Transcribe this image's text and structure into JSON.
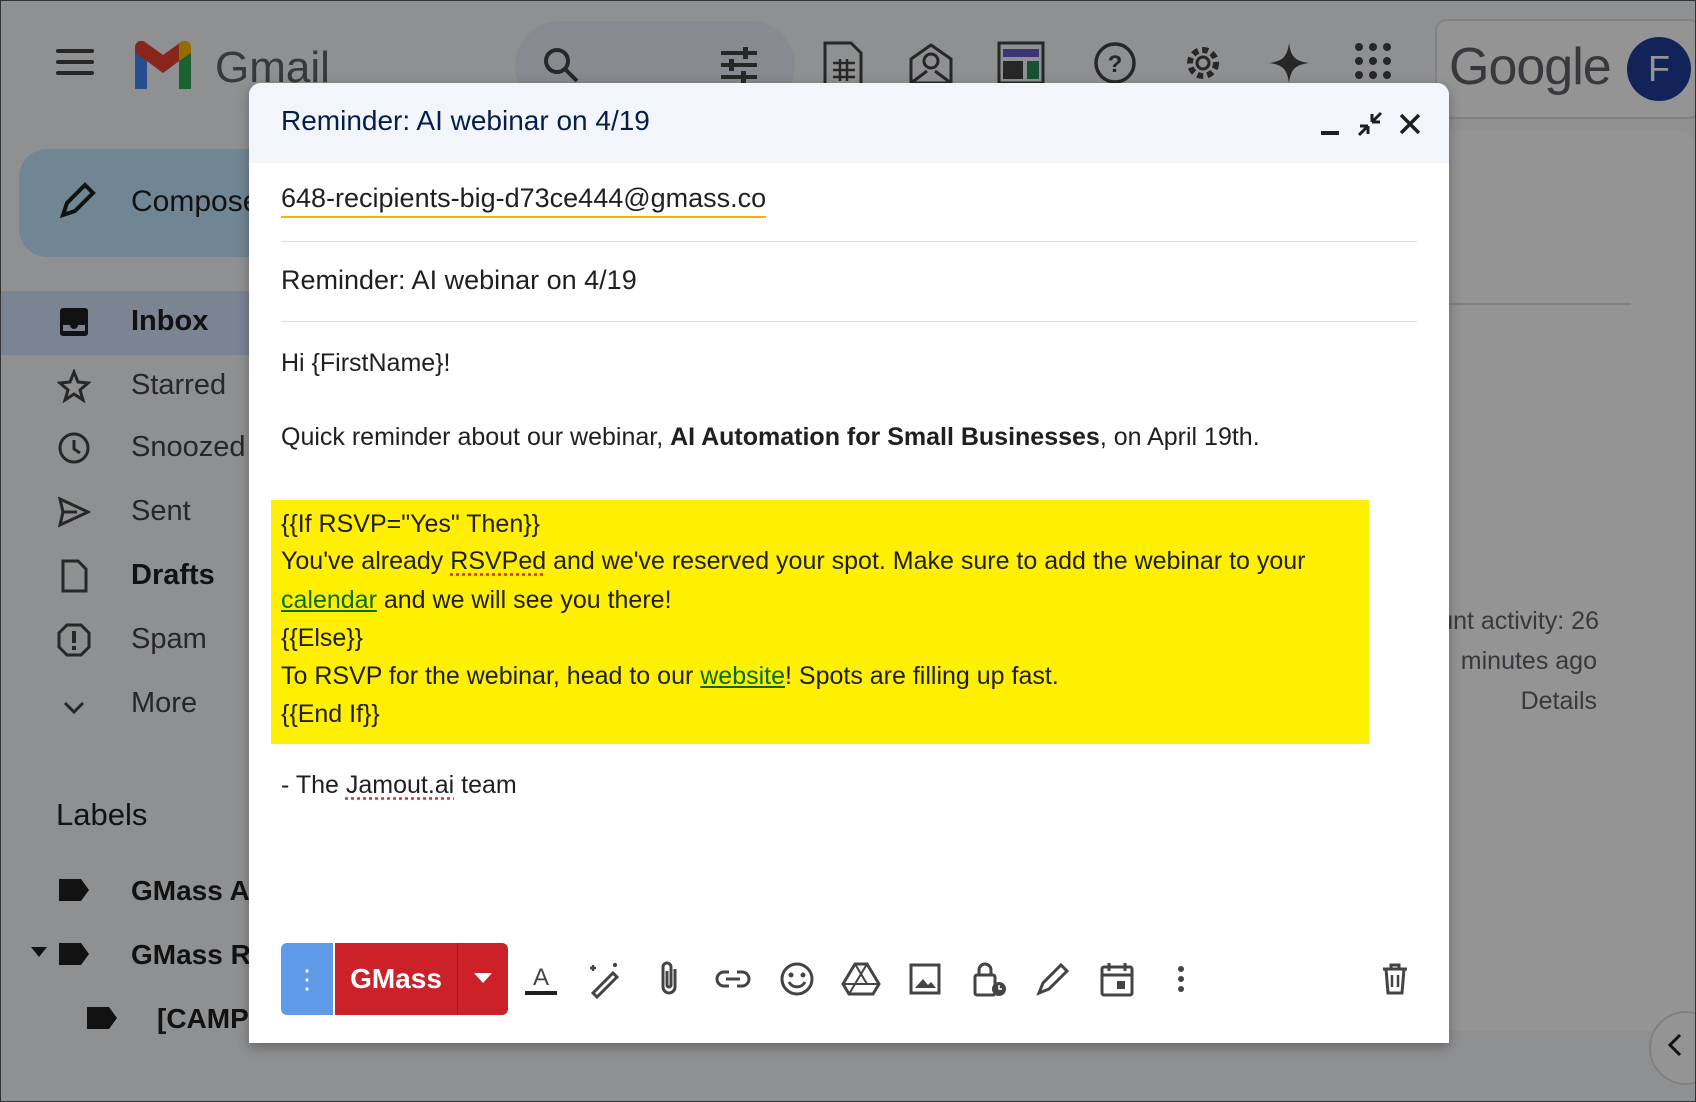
{
  "gmail": {
    "logo_text": "Gmail",
    "google_text": "Google",
    "avatar_letter": "F",
    "compose_label": "Compose",
    "nav": [
      {
        "label": "Inbox",
        "icon": "inbox-icon",
        "active": true
      },
      {
        "label": "Starred",
        "icon": "star-icon"
      },
      {
        "label": "Snoozed",
        "icon": "clock-icon"
      },
      {
        "label": "Sent",
        "icon": "send-icon"
      },
      {
        "label": "Drafts",
        "icon": "draft-icon"
      },
      {
        "label": "Spam",
        "icon": "spam-icon"
      },
      {
        "label": "More",
        "icon": "chevron-down-icon"
      }
    ],
    "labels_heading": "Labels",
    "labels": [
      "GMass A",
      "GMass R",
      "[CAMP"
    ],
    "activity_line1": "unt activity: 26",
    "activity_line2": "minutes ago",
    "details_link": "Details"
  },
  "compose": {
    "title": "Reminder: AI webinar on 4/19",
    "to": "648-recipients-big-d73ce444@gmass.co",
    "subject": "Reminder: AI webinar on 4/19",
    "greeting": "Hi {FirstName}!",
    "line1_pre": "Quick reminder about our webinar, ",
    "line1_bold": "AI Automation for Small Businesses",
    "line1_post": ", on April 19th.",
    "cond_if": "{{If RSVP=\"Yes\" Then}}",
    "cond_yes_pre": "You've already ",
    "cond_yes_spell": "RSVPed",
    "cond_yes_post": " and we've reserved your spot. Make sure to add the webinar to your",
    "cond_yes_link": "calendar",
    "cond_yes_end": " and we will see you there!",
    "cond_else": "{{Else}}",
    "cond_no_pre": "To RSVP for the webinar, head to our ",
    "cond_no_link": "website",
    "cond_no_post": "! Spots are filling up fast.",
    "cond_end": "{{End If}}",
    "sign_pre": "- The ",
    "sign_spell": "Jamout.ai",
    "sign_post": " team",
    "more_glyph": "⋮",
    "gmass_label": "GMass",
    "highlight_color": "#ffef00",
    "gmass_color": "#cc2128"
  }
}
